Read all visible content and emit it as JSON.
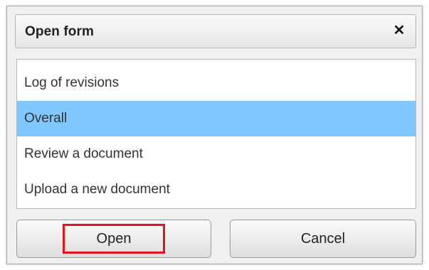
{
  "dialog": {
    "title": "Open form",
    "close_glyph": "✕",
    "close_icon": "close-icon"
  },
  "list": {
    "items": [
      {
        "label": "Log of revisions",
        "selected": false
      },
      {
        "label": "Overall",
        "selected": true
      },
      {
        "label": "Review a document",
        "selected": false
      },
      {
        "label": "Upload a new document",
        "selected": false
      }
    ]
  },
  "buttons": {
    "open_label": "Open",
    "cancel_label": "Cancel"
  },
  "colors": {
    "selection": "#80c8ff",
    "highlight_outline": "#e0141e"
  }
}
